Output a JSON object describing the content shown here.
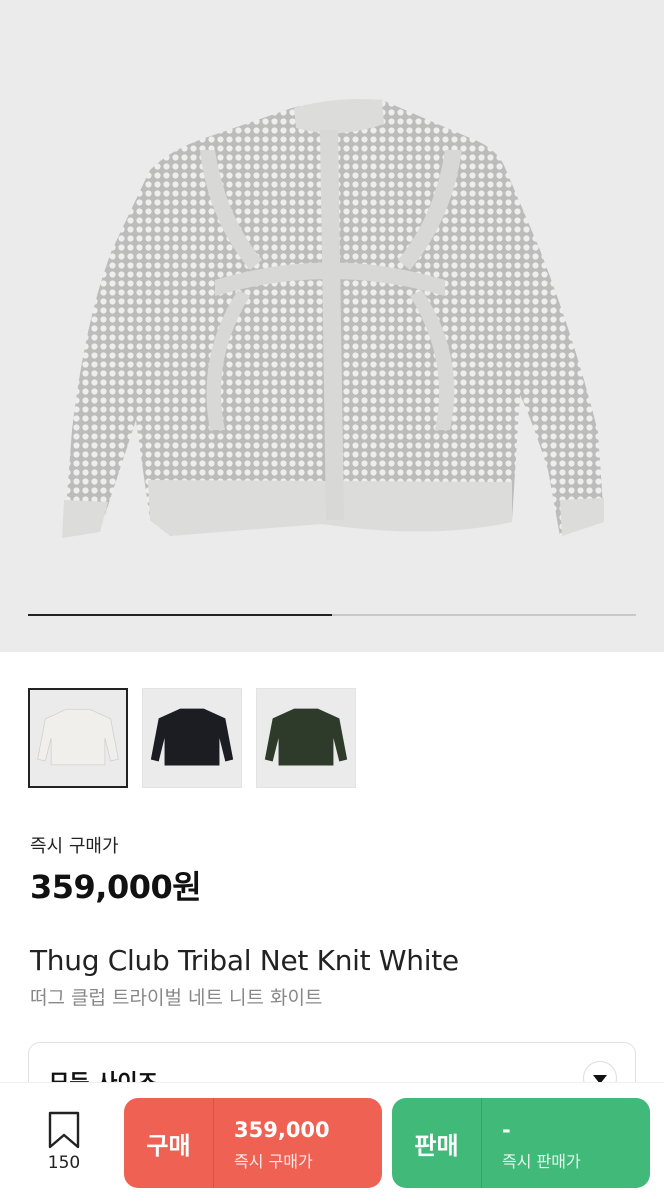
{
  "gallery": {
    "progress": 0.5,
    "thumbnails": [
      {
        "color": "#f0efec",
        "selected": true
      },
      {
        "color": "#1b1d22",
        "selected": false
      },
      {
        "color": "#2e3b2a",
        "selected": false
      }
    ]
  },
  "price_block": {
    "label": "즉시 구매가",
    "price": "359,000원"
  },
  "product": {
    "name_en": "Thug Club Tribal Net Knit White",
    "name_ko": "떠그 클럽 트라이벌 네트 니트 화이트"
  },
  "size_selector": {
    "label": "모든 사이즈"
  },
  "bottom_bar": {
    "wish_count": "150",
    "buy": {
      "label": "구매",
      "price": "359,000",
      "sub": "즉시 구매가",
      "color": "#ef6253"
    },
    "sell": {
      "label": "판매",
      "price": "-",
      "sub": "즉시 판매가",
      "color": "#41b979"
    }
  },
  "icons": [
    "bookmark-icon",
    "chevron-down-icon"
  ]
}
